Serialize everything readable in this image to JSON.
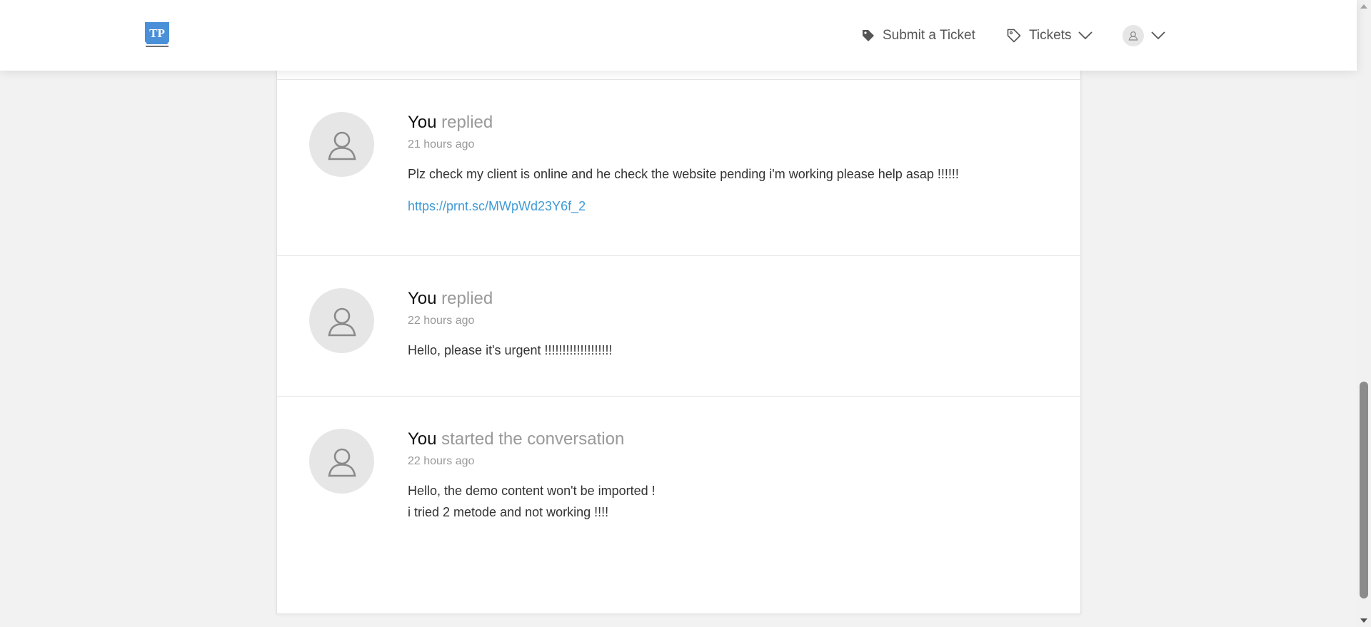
{
  "header": {
    "logo_text": "TP",
    "submit_label": "Submit a Ticket",
    "tickets_label": "Tickets"
  },
  "conversation": [
    {
      "author": "You",
      "action": "replied",
      "time": "21 hours ago",
      "lines": [
        "Plz check my client is online and he check the website pending i'm working please help asap !!!!!!"
      ],
      "link": "https://prnt.sc/MWpWd23Y6f_2"
    },
    {
      "author": "You",
      "action": "replied",
      "time": "22 hours ago",
      "lines": [
        "Hello, please it's urgent !!!!!!!!!!!!!!!!!!!"
      ]
    },
    {
      "author": "You",
      "action": "started the conversation",
      "time": "22 hours ago",
      "lines": [
        "Hello, the demo content won't be imported !",
        "i tried 2 metode and not working !!!!"
      ]
    }
  ],
  "icons": {
    "submit": "tag-icon",
    "tickets": "tag-outline-icon",
    "user": "user-icon",
    "dropdown": "chevron-down-icon"
  },
  "colors": {
    "link": "#3f9ad6",
    "logo": "#4a90d9",
    "background": "#f2f2f2"
  }
}
